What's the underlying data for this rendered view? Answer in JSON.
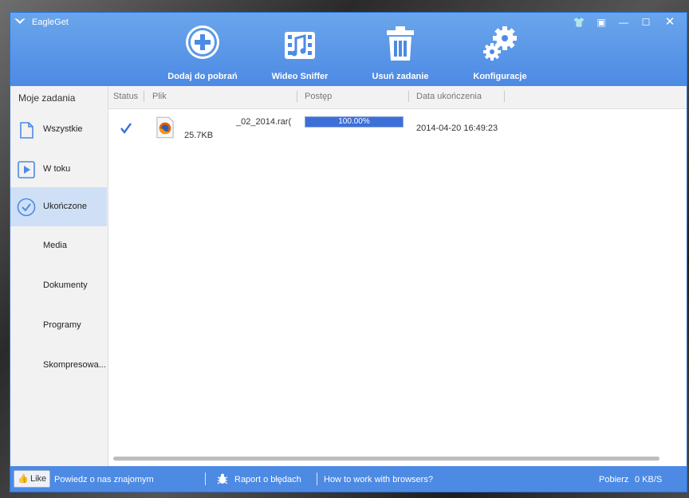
{
  "app": {
    "title": "EagleGet"
  },
  "toolbar": {
    "add_label": "Dodaj do pobrań",
    "sniffer_label": "Wideo Sniffer",
    "delete_label": "Usuń zadanie",
    "config_label": "Konfiguracje"
  },
  "sidebar": {
    "header": "Moje zadania",
    "items": [
      {
        "label": "Wszystkie",
        "icon": "file-icon"
      },
      {
        "label": "W toku",
        "icon": "play-icon"
      },
      {
        "label": "Ukończone",
        "icon": "check-circle-icon",
        "selected": true
      },
      {
        "label": "Media"
      },
      {
        "label": "Dokumenty"
      },
      {
        "label": "Programy"
      },
      {
        "label": "Skompresowa..."
      }
    ]
  },
  "columns": {
    "status": "Status",
    "file": "Plik",
    "progress": "Postęp",
    "date": "Data ukończenia"
  },
  "rows": [
    {
      "filename": "_02_2014.rar(",
      "size": "25.7KB",
      "progress_text": "100.00%",
      "progress": 1.0,
      "date": "2014-04-20 16:49:23",
      "file_icon": "firefox-file-icon",
      "status_icon": "check-icon"
    }
  ],
  "statusbar": {
    "like": "Like",
    "share": "Powiedz o nas znajomym",
    "report": "Raport o błędach",
    "howto": "How to work with browsers?",
    "download_label": "Pobierz",
    "download_speed": "0 KB/S"
  },
  "colors": {
    "accent": "#4d8ae4",
    "selected": "#cfe0f6",
    "progress": "#3d6fd8"
  }
}
